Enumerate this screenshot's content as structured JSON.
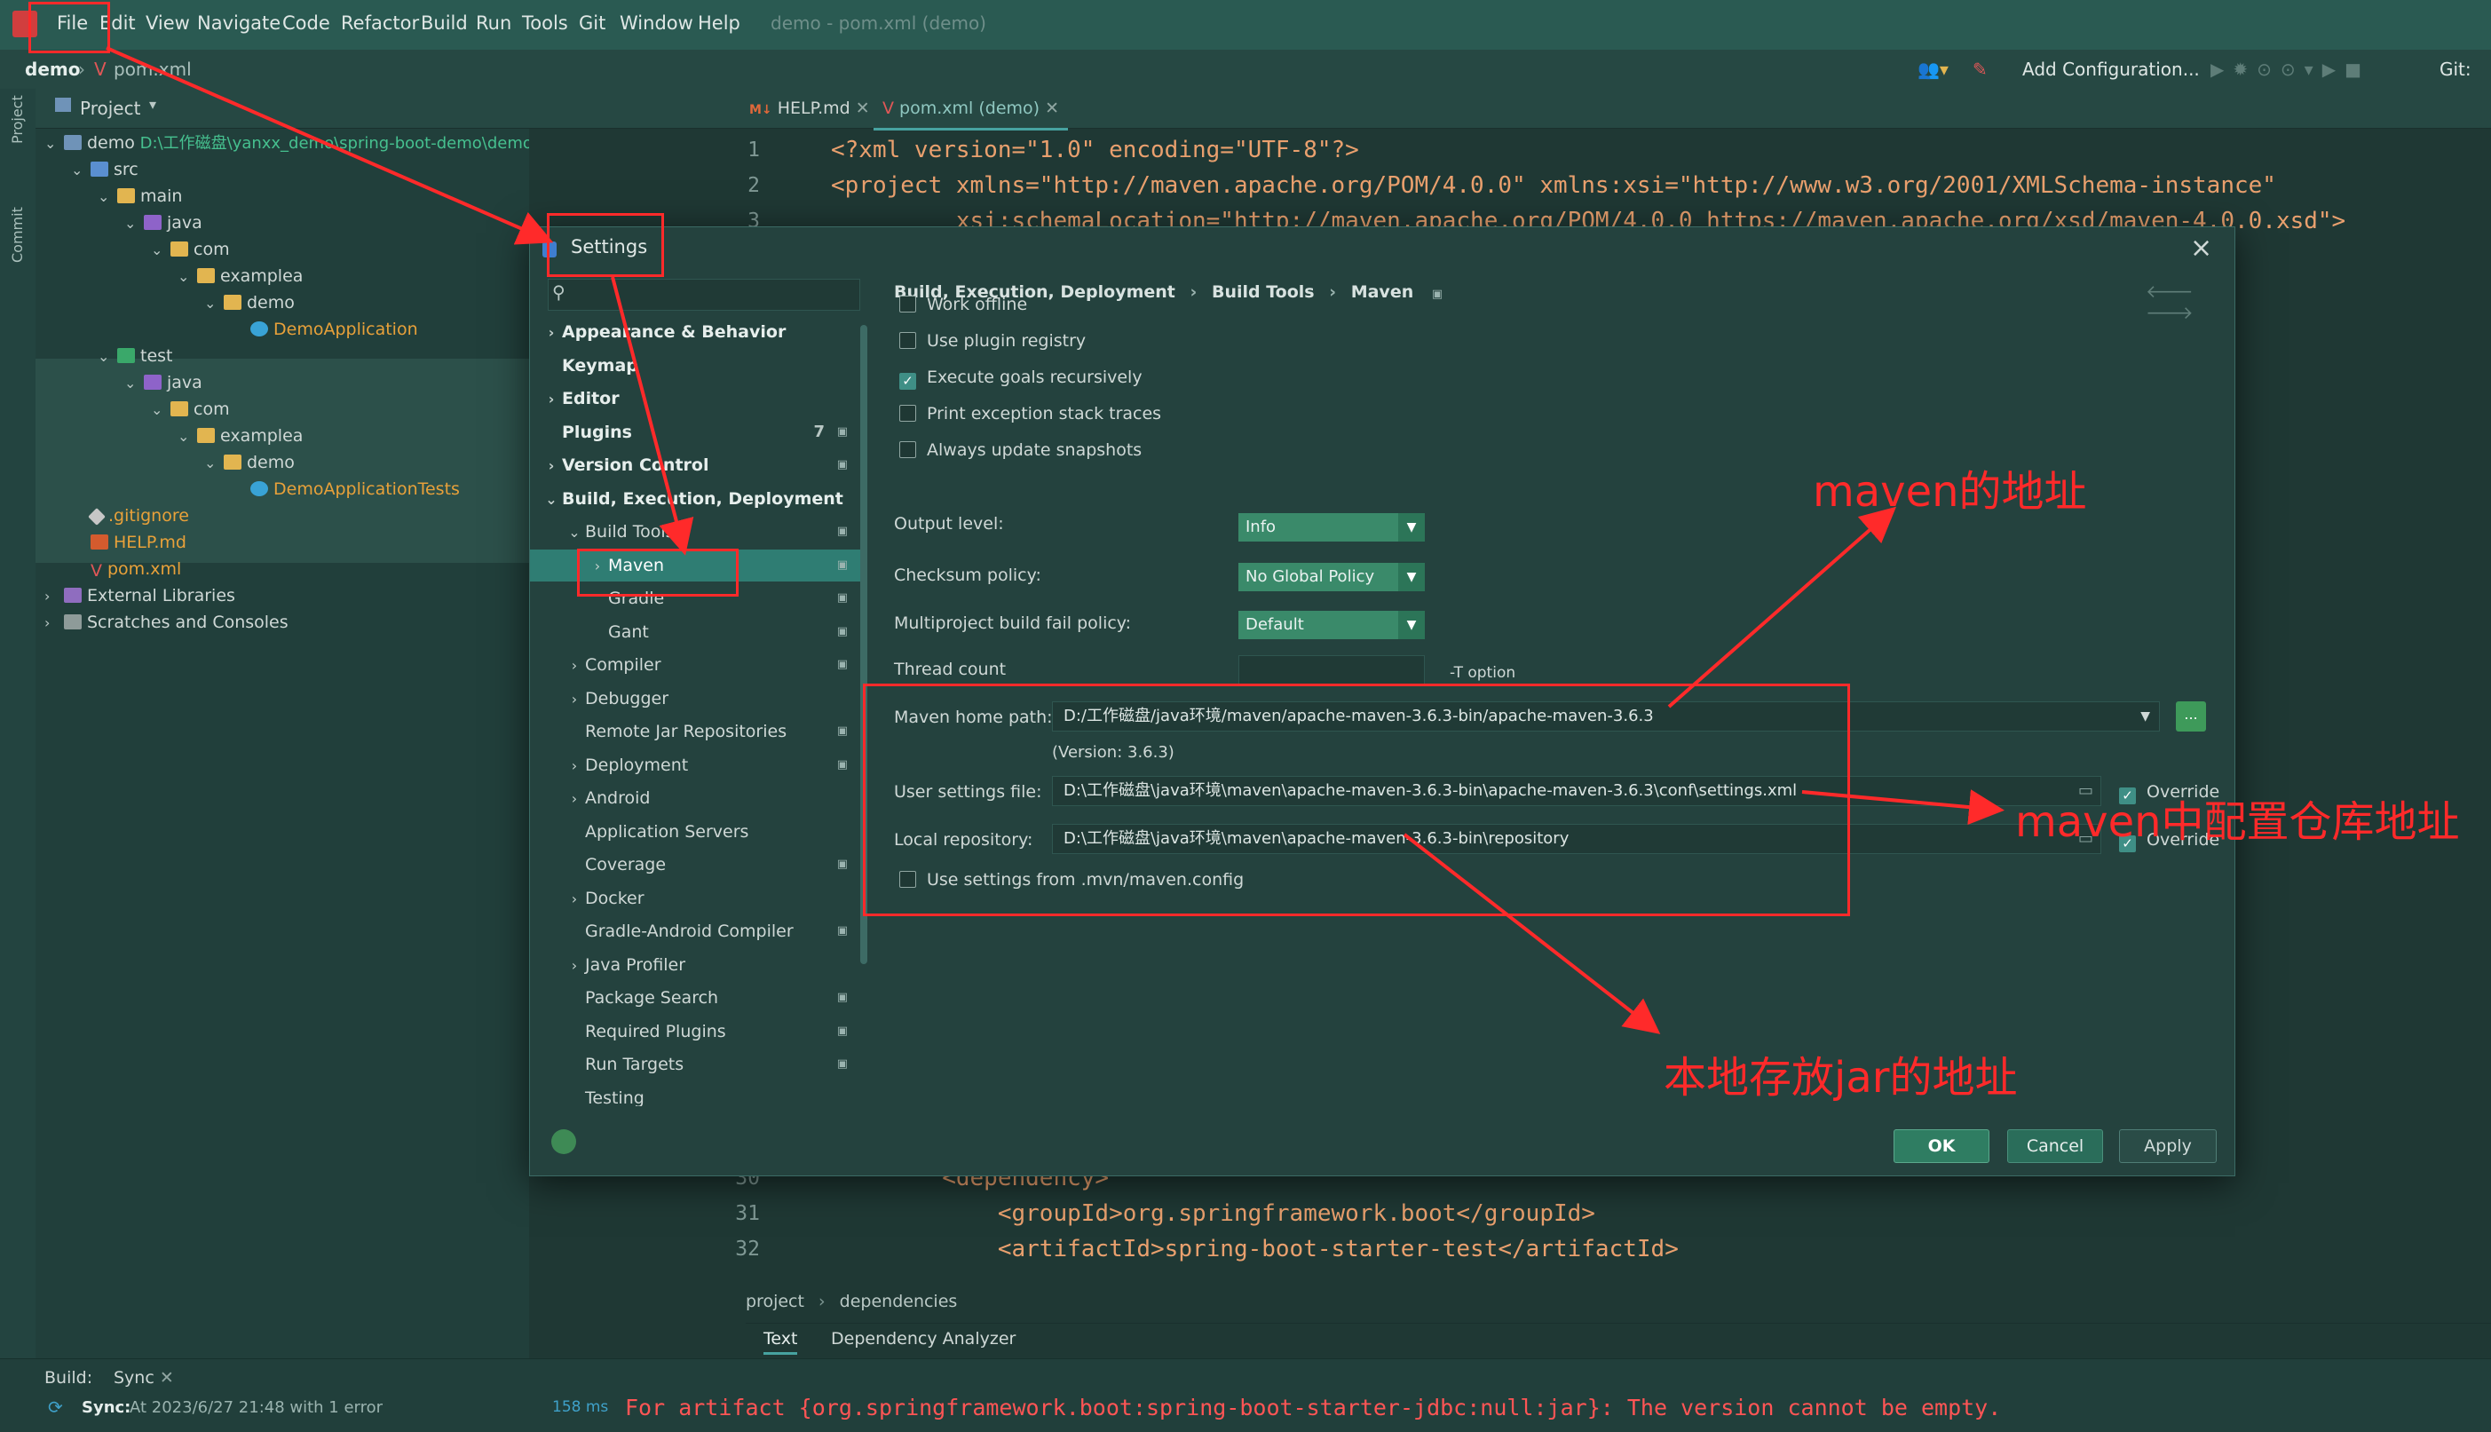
{
  "menubar": {
    "items": [
      "File",
      "Edit",
      "View",
      "Navigate",
      "Code",
      "Refactor",
      "Build",
      "Run",
      "Tools",
      "Git",
      "Window",
      "Help"
    ],
    "window_title": "demo - pom.xml (demo)"
  },
  "navbar": {
    "project": "demo",
    "file": "pom.xml",
    "add_config": "Add Configuration...",
    "git": "Git:"
  },
  "toolstrip": {
    "project_label": "Project",
    "commit_label": "Commit"
  },
  "project_panel": {
    "header": "Project",
    "tree": [
      {
        "label": "demo",
        "path": "D:\\工作磁盘\\yanxx_demo\\spring-boot-demo\\demo",
        "icon": "module",
        "depth": 0,
        "arrow": "v"
      },
      {
        "label": "src",
        "icon": "src",
        "depth": 1,
        "arrow": "v"
      },
      {
        "label": "main",
        "icon": "folder",
        "depth": 2,
        "arrow": "v"
      },
      {
        "label": "java",
        "icon": "java",
        "depth": 3,
        "arrow": "v"
      },
      {
        "label": "com",
        "icon": "folder",
        "depth": 4,
        "arrow": "v"
      },
      {
        "label": "examplea",
        "icon": "folder",
        "depth": 5,
        "arrow": "v"
      },
      {
        "label": "demo",
        "icon": "folder",
        "depth": 6,
        "arrow": "v"
      },
      {
        "label": "DemoApplication",
        "icon": "class",
        "depth": 7,
        "arrow": "",
        "color": "#e8a13a"
      },
      {
        "label": "test",
        "icon": "test",
        "depth": 2,
        "arrow": "v"
      },
      {
        "label": "java",
        "icon": "java",
        "depth": 3,
        "arrow": "v"
      },
      {
        "label": "com",
        "icon": "folder",
        "depth": 4,
        "arrow": "v"
      },
      {
        "label": "examplea",
        "icon": "folder",
        "depth": 5,
        "arrow": "v"
      },
      {
        "label": "demo",
        "icon": "folder",
        "depth": 6,
        "arrow": "v"
      },
      {
        "label": "DemoApplicationTests",
        "icon": "class",
        "depth": 7,
        "arrow": "",
        "color": "#e8a13a"
      },
      {
        "label": ".gitignore",
        "icon": "git",
        "depth": 1,
        "arrow": "",
        "color": "#e8a13a"
      },
      {
        "label": "HELP.md",
        "icon": "md",
        "depth": 1,
        "arrow": "",
        "color": "#e8a13a"
      },
      {
        "label": "pom.xml",
        "icon": "maven",
        "depth": 1,
        "arrow": "",
        "color": "#e8a13a"
      },
      {
        "label": "External Libraries",
        "icon": "lib",
        "depth": 0,
        "arrow": ">"
      },
      {
        "label": "Scratches and Consoles",
        "icon": "scratch",
        "depth": 0,
        "arrow": ">"
      }
    ]
  },
  "editor": {
    "tabs": [
      "HELP.md",
      "pom.xml (demo)"
    ],
    "top_lines": [
      {
        "num": "1",
        "text": "<?xml version=\"1.0\" encoding=\"UTF-8\"?>"
      },
      {
        "num": "2",
        "text": "<project xmlns=\"http://maven.apache.org/POM/4.0.0\" xmlns:xsi=\"http://www.w3.org/2001/XMLSchema-instance\""
      },
      {
        "num": "3",
        "text": "         xsi:schemaLocation=\"http://maven.apache.org/POM/4.0.0 https://maven.apache.org/xsd/maven-4.0.0.xsd\">"
      }
    ],
    "bottom_lines": [
      {
        "num": "30",
        "text": "        <dependency>"
      },
      {
        "num": "31",
        "text": "            <groupId>org.springframework.boot</groupId>"
      },
      {
        "num": "32",
        "text": "            <artifactId>spring-boot-starter-test</artifactId>"
      }
    ],
    "breadcrumb": [
      "project",
      "dependencies"
    ],
    "bottom_tabs": [
      "Text",
      "Dependency Analyzer"
    ]
  },
  "build": {
    "label": "Build:",
    "tab": "Sync",
    "sync_title": "Sync:",
    "sync_text": "At 2023/6/27 21:48 with 1 error",
    "time": "158 ms",
    "error": "For artifact {org.springframework.boot:spring-boot-starter-jdbc:null:jar}: The version cannot be empty."
  },
  "settings": {
    "title": "Settings",
    "breadcrumb": [
      "Build, Execution, Deployment",
      "Build Tools",
      "Maven"
    ],
    "nav": [
      {
        "label": "Appearance & Behavior",
        "arrow": ">",
        "indent": 0,
        "bold": true
      },
      {
        "label": "Keymap",
        "arrow": "",
        "indent": 0,
        "bold": true
      },
      {
        "label": "Editor",
        "arrow": ">",
        "indent": 0,
        "bold": true
      },
      {
        "label": "Plugins",
        "arrow": "",
        "indent": 0,
        "bold": true,
        "num": "7",
        "badge": true
      },
      {
        "label": "Version Control",
        "arrow": ">",
        "indent": 0,
        "bold": true,
        "badge": true
      },
      {
        "label": "Build, Execution, Deployment",
        "arrow": "v",
        "indent": 0,
        "bold": true
      },
      {
        "label": "Build Tools",
        "arrow": "v",
        "indent": 1,
        "badge": true
      },
      {
        "label": "Maven",
        "arrow": ">",
        "indent": 2,
        "badge": true,
        "selected": true
      },
      {
        "label": "Gradle",
        "arrow": "",
        "indent": 2,
        "badge": true
      },
      {
        "label": "Gant",
        "arrow": "",
        "indent": 2,
        "badge": true
      },
      {
        "label": "Compiler",
        "arrow": ">",
        "indent": 1,
        "badge": true
      },
      {
        "label": "Debugger",
        "arrow": ">",
        "indent": 1
      },
      {
        "label": "Remote Jar Repositories",
        "arrow": "",
        "indent": 1,
        "badge": true
      },
      {
        "label": "Deployment",
        "arrow": ">",
        "indent": 1,
        "badge": true
      },
      {
        "label": "Android",
        "arrow": ">",
        "indent": 1
      },
      {
        "label": "Application Servers",
        "arrow": "",
        "indent": 1
      },
      {
        "label": "Coverage",
        "arrow": "",
        "indent": 1,
        "badge": true
      },
      {
        "label": "Docker",
        "arrow": ">",
        "indent": 1
      },
      {
        "label": "Gradle-Android Compiler",
        "arrow": "",
        "indent": 1,
        "badge": true
      },
      {
        "label": "Java Profiler",
        "arrow": ">",
        "indent": 1
      },
      {
        "label": "Package Search",
        "arrow": "",
        "indent": 1,
        "badge": true
      },
      {
        "label": "Required Plugins",
        "arrow": "",
        "indent": 1,
        "badge": true
      },
      {
        "label": "Run Targets",
        "arrow": "",
        "indent": 1,
        "badge": true
      },
      {
        "label": "Testing",
        "arrow": "",
        "indent": 1
      }
    ],
    "checkboxes": [
      {
        "label": "Work offline",
        "checked": false
      },
      {
        "label": "Use plugin registry",
        "checked": false
      },
      {
        "label": "Execute goals recursively",
        "checked": true
      },
      {
        "label": "Print exception stack traces",
        "checked": false
      },
      {
        "label": "Always update snapshots",
        "checked": false
      }
    ],
    "output_level": {
      "label": "Output level:",
      "value": "Info"
    },
    "checksum": {
      "label": "Checksum policy:",
      "value": "No Global Policy"
    },
    "multiproject": {
      "label": "Multiproject build fail policy:",
      "value": "Default"
    },
    "thread_count": {
      "label": "Thread count",
      "value": "",
      "hint": "-T option"
    },
    "maven_home": {
      "label": "Maven home path:",
      "value": "D:/工作磁盘/java环境/maven/apache-maven-3.6.3-bin/apache-maven-3.6.3",
      "version": "(Version: 3.6.3)",
      "browse": "..."
    },
    "user_settings": {
      "label": "User settings file:",
      "value": "D:\\工作磁盘\\java环境\\maven\\apache-maven-3.6.3-bin\\apache-maven-3.6.3\\conf\\settings.xml",
      "override": "Override",
      "override_checked": true
    },
    "local_repo": {
      "label": "Local repository:",
      "value": "D:\\工作磁盘\\java环境\\maven\\apache-maven-3.6.3-bin\\repository",
      "override": "Override",
      "override_checked": true
    },
    "mvn_config": {
      "label": "Use settings from .mvn/maven.config",
      "checked": false
    },
    "buttons": {
      "ok": "OK",
      "cancel": "Cancel",
      "apply": "Apply"
    }
  },
  "annotations": {
    "maven_addr": "maven的地址",
    "settings_repo": "maven中配置仓库地址",
    "local_jar": "本地存放jar的地址"
  },
  "colors": {
    "accent": "#2f7d73",
    "annotation": "#ff2a2a",
    "error": "#ff5555"
  }
}
